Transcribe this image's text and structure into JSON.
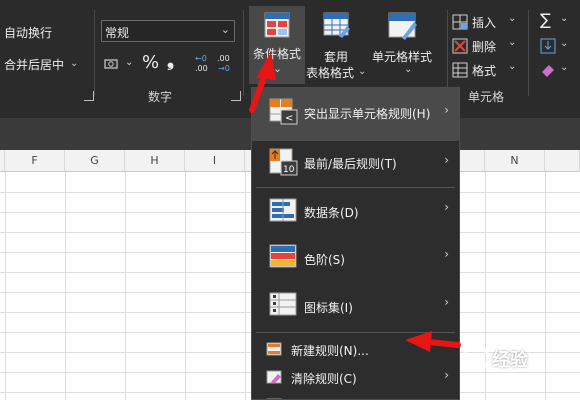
{
  "ribbon": {
    "alignment": {
      "wrap_text": "自动换行",
      "merge_center": "合并后居中"
    },
    "number": {
      "format_value": "常规",
      "percent_symbol": "%",
      "comma_symbol": "❟",
      "increase_decimal": "←0 .00",
      "decrease_decimal": ".00 →0",
      "group_label": "数字"
    },
    "styles": {
      "conditional_formatting": "条件格式",
      "format_as_table_line1": "套用",
      "format_as_table_line2": "表格格式",
      "cell_styles": "单元格样式"
    },
    "cells": {
      "insert": "插入",
      "delete": "删除",
      "format": "格式",
      "group_label": "单元格"
    },
    "editing": {
      "sum_symbol": "∑"
    }
  },
  "grid": {
    "columns": [
      "F",
      "G",
      "H",
      "I",
      "N"
    ]
  },
  "menu": {
    "items": [
      {
        "label": "突出显示单元格规则(H)",
        "icon": "highlight-cells-rules-icon",
        "submenu": true
      },
      {
        "label": "最前/最后规则(T)",
        "icon": "top-bottom-rules-icon",
        "submenu": true
      },
      {
        "label": "数据条(D)",
        "icon": "data-bars-icon",
        "submenu": true
      },
      {
        "label": "色阶(S)",
        "icon": "color-scales-icon",
        "submenu": true
      },
      {
        "label": "图标集(I)",
        "icon": "icon-sets-icon",
        "submenu": true
      }
    ],
    "actions": [
      {
        "label": "新建规则(N)...",
        "icon": "new-rule-icon"
      },
      {
        "label": "清除规则(C)",
        "icon": "clear-rules-icon"
      }
    ]
  },
  "colors": {
    "ribbon_bg": "#2b2b2b",
    "menu_bg": "#2d2d2d",
    "menu_hover": "#4a4a4a",
    "annotation_red": "#e81515"
  }
}
